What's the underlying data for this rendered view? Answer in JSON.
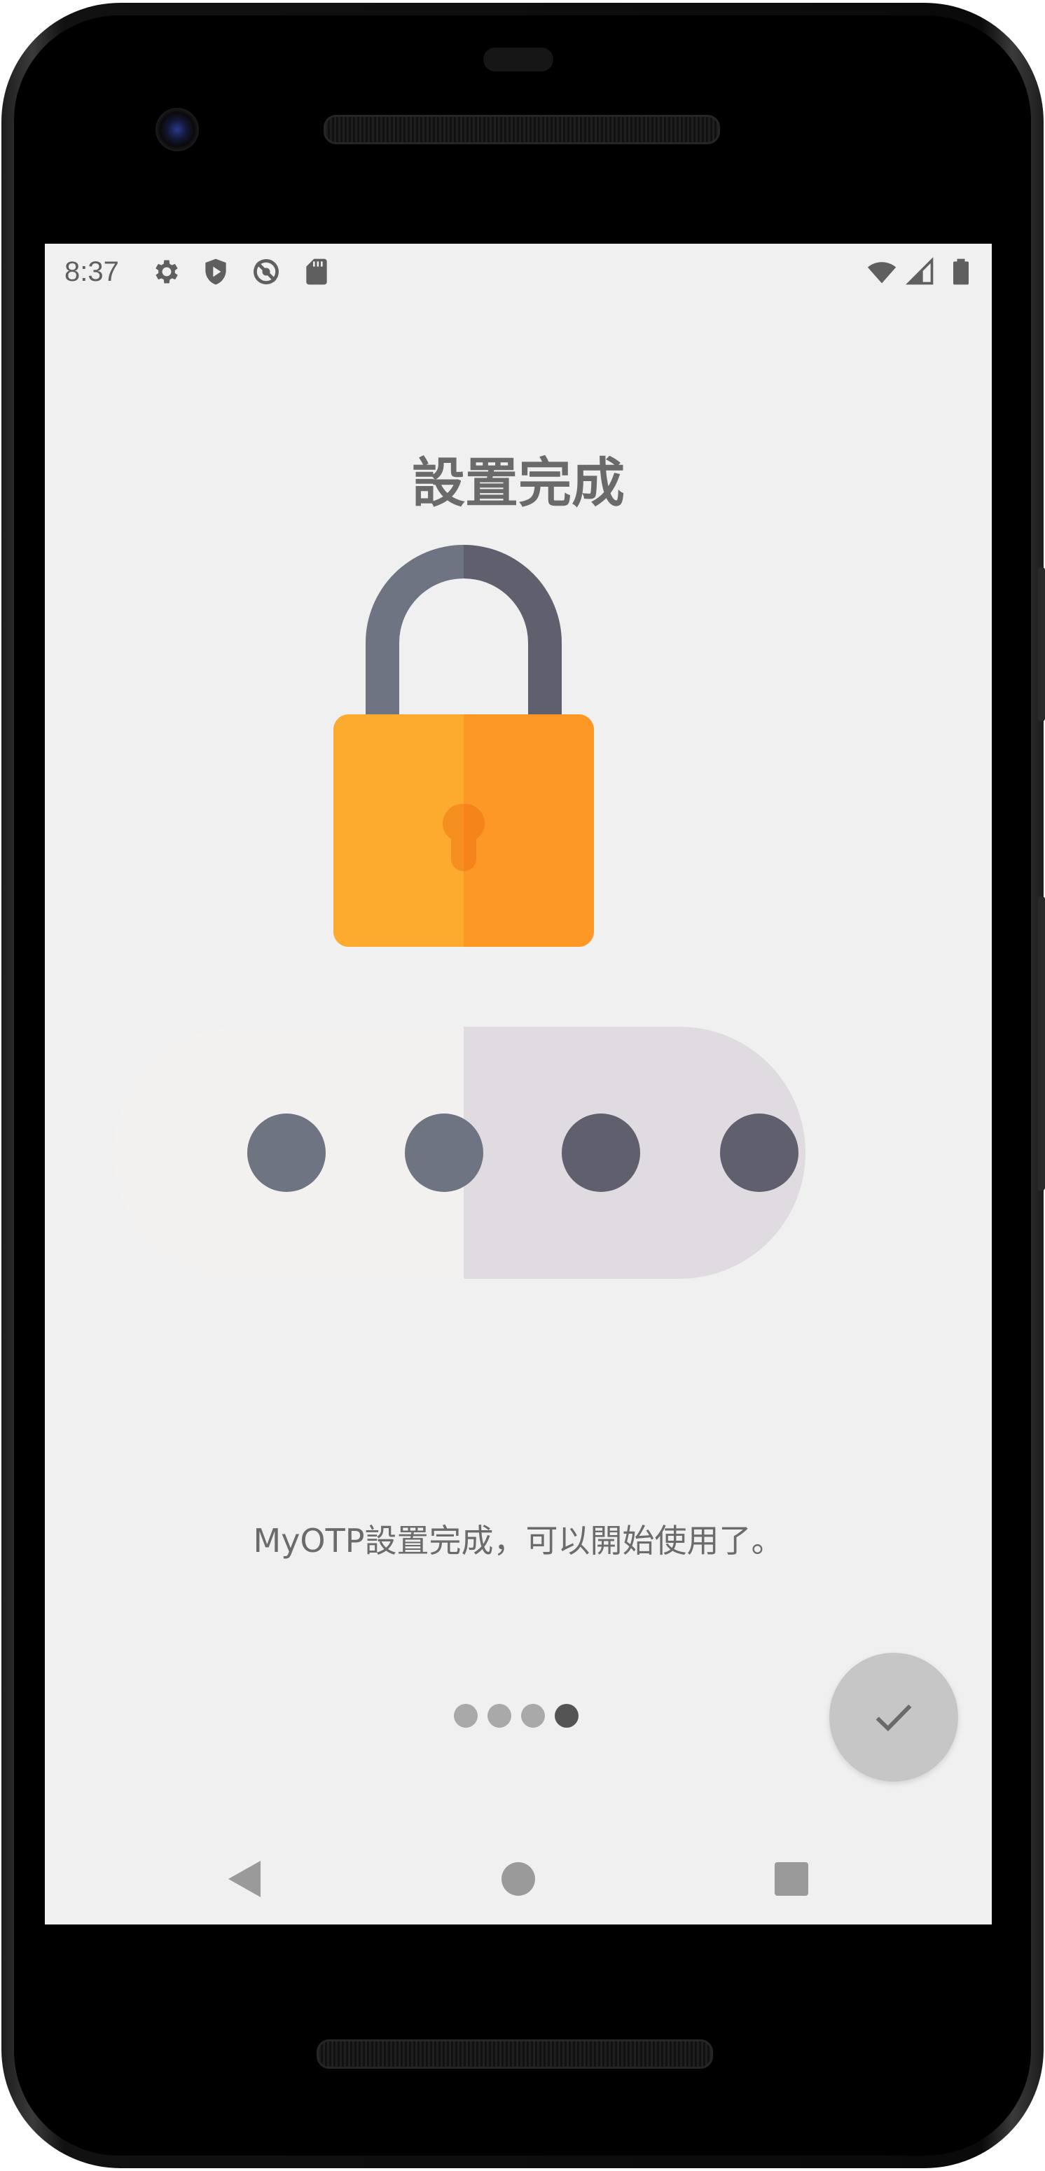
{
  "status_bar": {
    "time": "8:37",
    "left_icons": [
      "gear-icon",
      "shield-play-icon",
      "no-sync-icon",
      "sd-card-icon"
    ],
    "right_icons": [
      "wifi-icon",
      "signal-icon",
      "battery-icon"
    ]
  },
  "page": {
    "title": "設置完成",
    "illustration": "padlock-password-icon",
    "message": "MyOTP設置完成，可以開始使用了。"
  },
  "pager": {
    "total": 4,
    "current": 4
  },
  "fab": {
    "icon": "check-icon"
  },
  "nav_bar": {
    "back": "back-icon",
    "home": "home-icon",
    "recents": "recents-icon"
  },
  "colors": {
    "screen_bg": "#f0f0f0",
    "lock_body_left": "#fdab2e",
    "lock_body_right": "#fd9726",
    "shackle_left": "#6f7483",
    "shackle_right": "#5f5f6d",
    "pill_left": "#f3f0f0",
    "pill_right": "#dfdbe0"
  }
}
